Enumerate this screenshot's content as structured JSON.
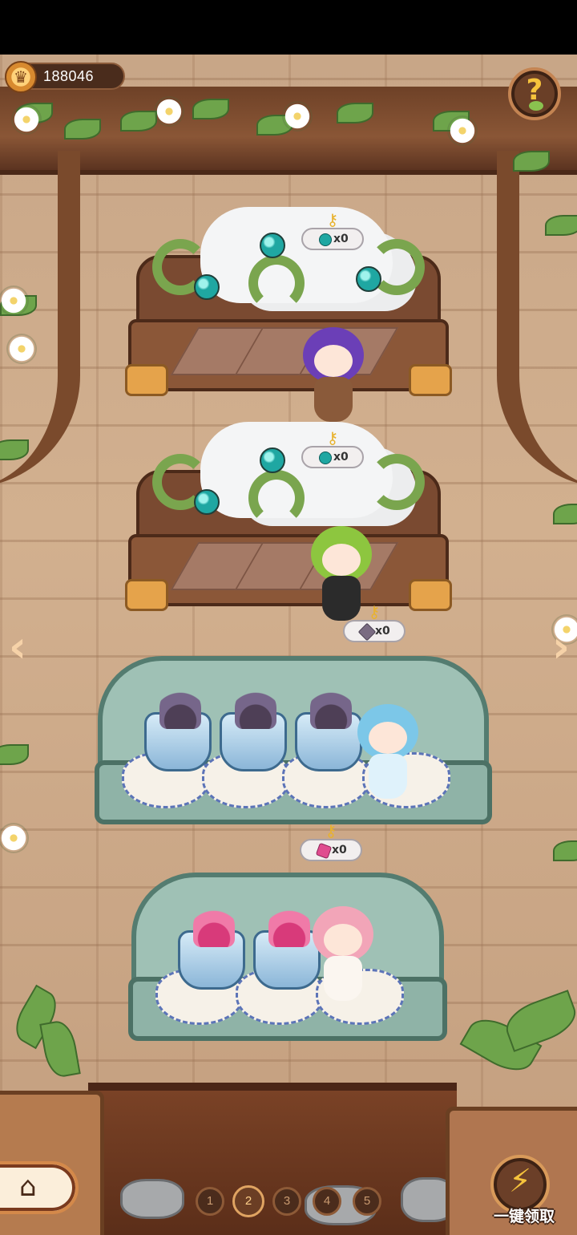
{
  "currency": {
    "amount": "188046",
    "icon": "crown-coin-icon"
  },
  "help": {
    "label": "?"
  },
  "beds": [
    {
      "resource_count": "x0",
      "resource": "teal-gem"
    },
    {
      "resource_count": "x0",
      "resource": "teal-gem"
    }
  ],
  "shelves": [
    {
      "resource_count": "x0",
      "resource": "seaweed"
    },
    {
      "resource_count": "x0",
      "resource": "coral"
    }
  ],
  "nav": {
    "prev": "‹",
    "next": "›"
  },
  "home": {
    "icon": "home-icon",
    "glyph": "⌂"
  },
  "pager": {
    "pages": [
      "1",
      "2",
      "3",
      "4",
      "5"
    ],
    "active": "2"
  },
  "collect": {
    "label": "一键领取",
    "icon": "lightning-icon",
    "glyph": "⚡"
  },
  "colors": {
    "wood": "#7a4a31",
    "shelf": "#9fc1b5",
    "accent": "#f6c33c"
  }
}
